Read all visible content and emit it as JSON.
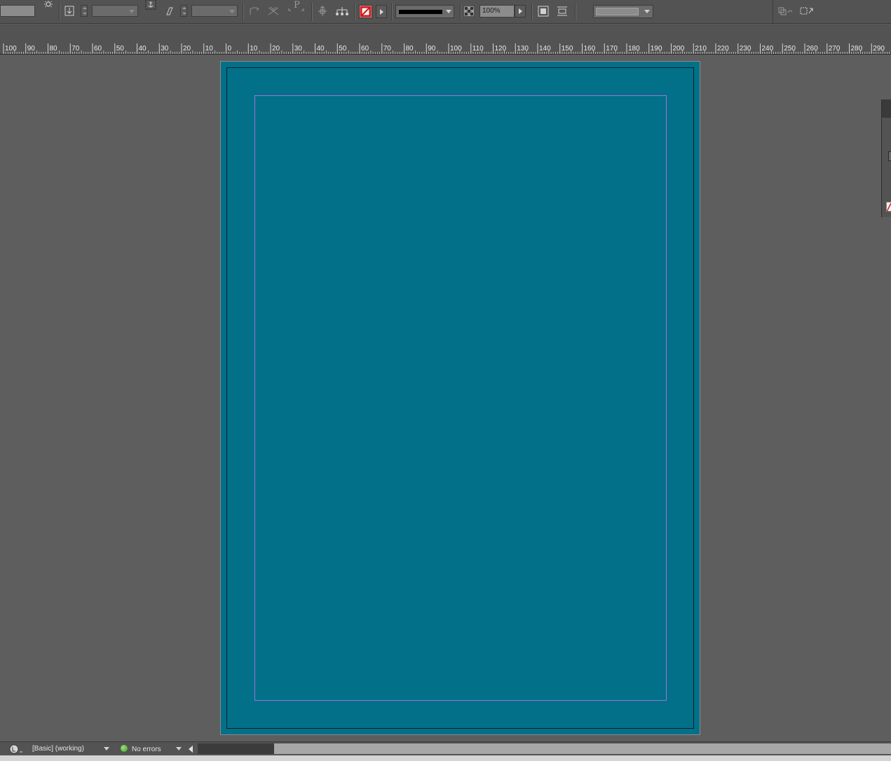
{
  "control_bar": {
    "zoom_value": "100%",
    "icons": [
      "sun-icon",
      "baseline-shift-icon",
      "anchor-icon",
      "skew-icon",
      "paragraph-icon",
      "flip-icon",
      "rotate-icon",
      "distribute-icon",
      "stroke-none-icon",
      "opacity-icon",
      "text-wrap-icon",
      "align-icon",
      "object-states-icon"
    ]
  },
  "ruler": {
    "labels": [
      "100",
      "90",
      "80",
      "70",
      "60",
      "50",
      "40",
      "30",
      "20",
      "10",
      "0",
      "10",
      "20",
      "30",
      "40",
      "50",
      "60",
      "70",
      "80",
      "90",
      "100",
      "110",
      "120",
      "130",
      "140",
      "150",
      "160",
      "170",
      "180",
      "190",
      "200",
      "210",
      "220",
      "230",
      "240",
      "250",
      "260",
      "270",
      "280",
      "290"
    ]
  },
  "document": {
    "page_color": "#017088",
    "margin_guide_color": "#a071e0"
  },
  "status_bar": {
    "preflight_profile": "[Basic] (working)",
    "preflight_status": "No errors",
    "status_color": "#4caf2a"
  }
}
